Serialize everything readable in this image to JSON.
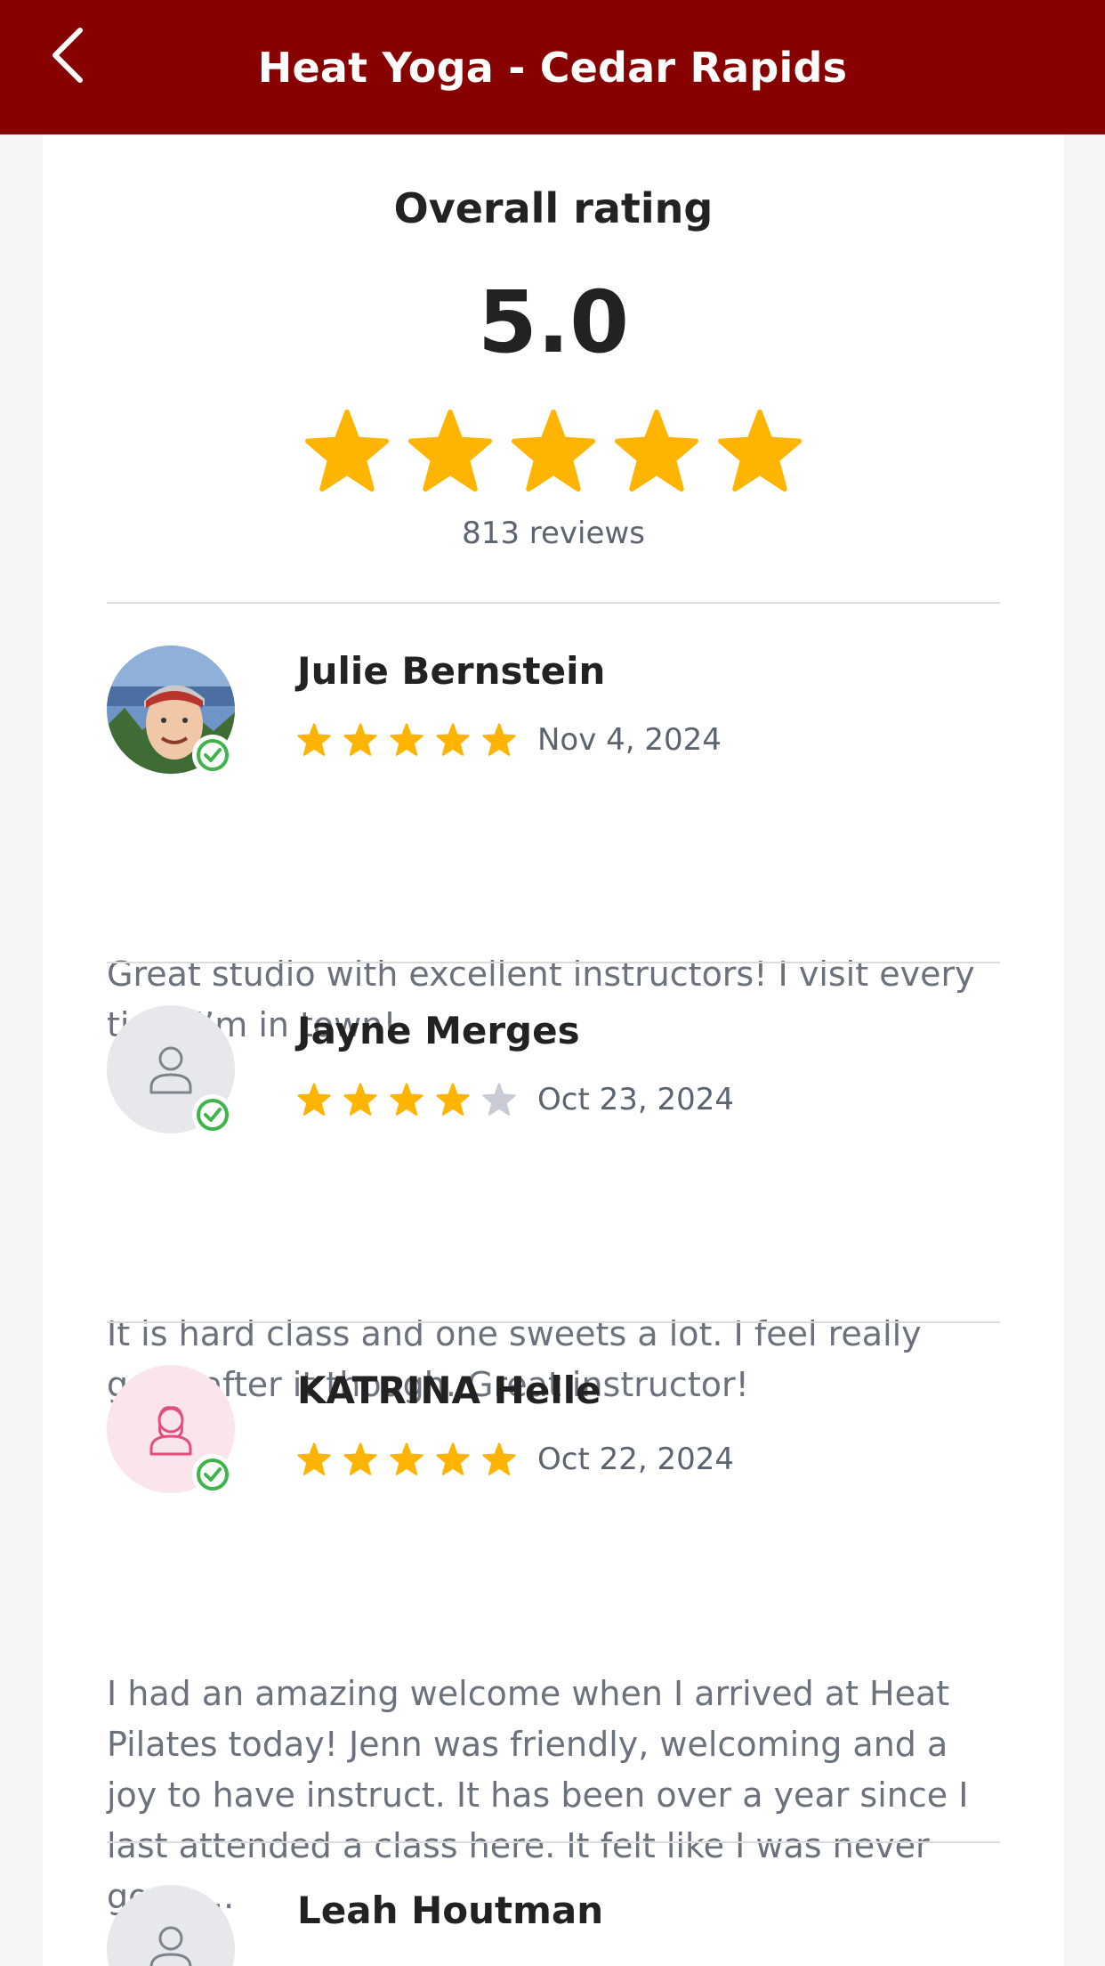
{
  "header": {
    "title": "Heat Yoga - Cedar Rapids",
    "back_icon": "chevron-left-icon",
    "background": "#870101"
  },
  "summary": {
    "title": "Overall rating",
    "value": "5.0",
    "stars": 5,
    "reviews_count": "813 reviews"
  },
  "colors": {
    "star_filled": "#FFB400",
    "star_empty": "#C9CBD6",
    "verified": "#3DB54A"
  },
  "reviews": [
    {
      "name": "Julie Bernstein",
      "date": "Nov 4, 2024",
      "rating": 5,
      "avatar": "photo",
      "verified": true,
      "text": "Great studio with excellent instructors! I visit every time I’m in town!"
    },
    {
      "name": "Jayne Merges",
      "date": "Oct 23, 2024",
      "rating": 4,
      "avatar": "person-icon",
      "verified": true,
      "text": "It is hard class and one sweets a lot. I feel really good after it though. Great instructor!"
    },
    {
      "name": "KATRINA Helle",
      "date": "Oct 22, 2024",
      "rating": 5,
      "avatar": "woman-icon",
      "verified": true,
      "text": "I had an amazing welcome when I arrived at Heat Pilates today! Jenn was friendly, welcoming and a joy to have instruct. It has been over a year since I last attended a class here. It felt like I was never gone...."
    },
    {
      "name": "Leah Houtman",
      "avatar": "person-icon"
    }
  ]
}
